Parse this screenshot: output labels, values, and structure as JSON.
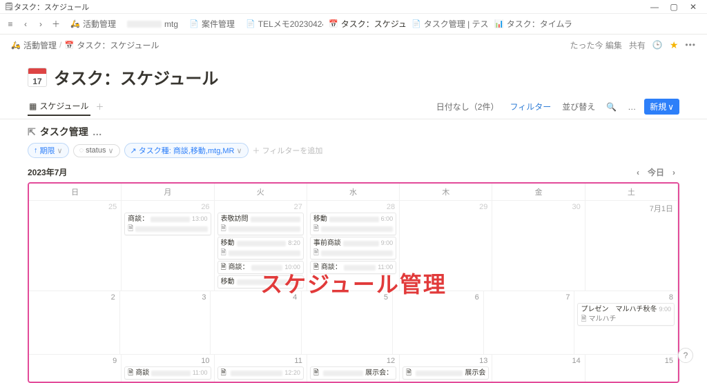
{
  "window": {
    "title": "タスク：スケジュール"
  },
  "tabs": [
    {
      "icon": "🛵",
      "label": "活動管理"
    },
    {
      "icon": "",
      "label": "mtg"
    },
    {
      "icon": "📄",
      "label": "案件管理"
    },
    {
      "icon": "📄",
      "label": "TELメモ20230424-"
    },
    {
      "icon": "📅",
      "label": "タスク：スケジュ…",
      "active": true
    },
    {
      "icon": "📄",
      "label": "タスク管理 | テス…"
    },
    {
      "icon": "📊",
      "label": "タスク：タイムラ…"
    }
  ],
  "breadcrumb": {
    "root_icon": "🛵",
    "root": "活動管理",
    "sep": "/",
    "page_icon": "📅",
    "page": "タスク：スケジュール"
  },
  "topright": {
    "edited": "たった今 編集",
    "share": "共有",
    "more": "•••"
  },
  "page": {
    "icon_num": "17",
    "title": "タスク：スケジュール"
  },
  "view": {
    "tab_label": "スケジュール",
    "plus": "＋",
    "no_date": "日付なし（2件）",
    "filter": "フィルター",
    "sort": "並び替え",
    "search_icon": "Q",
    "more": "…",
    "new": "新規",
    "new_caret": "∨"
  },
  "db": {
    "name": "タスク管理",
    "more": "…"
  },
  "filters": {
    "period": "期限",
    "period_caret": "∨",
    "status": "status",
    "status_caret": "∨",
    "task_type": "タスク種: 商談,移動,mtg,MR",
    "task_caret": "∨",
    "add": "＋ フィルターを追加",
    "updown": "↑"
  },
  "month": {
    "label": "2023年7月",
    "today": "今日",
    "lt": "‹",
    "gt": "›"
  },
  "dow": [
    "日",
    "月",
    "火",
    "水",
    "木",
    "金",
    "土"
  ],
  "weeks": [
    {
      "days": [
        {
          "n": "25",
          "other": true
        },
        {
          "n": "26",
          "other": true,
          "events": [
            {
              "t": "商談：",
              "blurred": true,
              "time": "13:00",
              "doc": true
            }
          ]
        },
        {
          "n": "27",
          "other": true,
          "events": [
            {
              "t": "表敬訪問",
              "blurred": true,
              "time": "",
              "doc": true
            },
            {
              "t": "移動",
              "blurred": true,
              "time": "8:20",
              "doc": true
            },
            {
              "t": "商談：",
              "sub": true,
              "blurred": true,
              "time": "10:00"
            },
            {
              "t": "移動",
              "blurred": true,
              "time": "",
              "doc": false
            }
          ]
        },
        {
          "n": "28",
          "other": true,
          "events": [
            {
              "t": "移動",
              "blurred": true,
              "time": "6:00",
              "doc": true
            },
            {
              "t": "事前商談",
              "blurred": true,
              "time": "9:00",
              "doc": true
            },
            {
              "t": "商談：",
              "sub": true,
              "blurred": true,
              "time": "11:00"
            }
          ]
        },
        {
          "n": "29",
          "other": true
        },
        {
          "n": "30",
          "other": true
        },
        {
          "n": "7月1日"
        }
      ]
    },
    {
      "days": [
        {
          "n": "2"
        },
        {
          "n": "3"
        },
        {
          "n": "4"
        },
        {
          "n": "5"
        },
        {
          "n": "6"
        },
        {
          "n": "7"
        },
        {
          "n": "8",
          "events": [
            {
              "t": "プレゼン　マルハチ秋冬",
              "time": "9:00",
              "doclabel": "マルハチ"
            }
          ]
        }
      ]
    },
    {
      "days": [
        {
          "n": "9"
        },
        {
          "n": "10",
          "events": [
            {
              "t": "商談",
              "blurred": true,
              "time": "11:00",
              "sub": true
            }
          ]
        },
        {
          "n": "11",
          "events": [
            {
              "t": "",
              "blurred": true,
              "time": "12:20",
              "sub": true
            }
          ]
        },
        {
          "n": "12",
          "events": [
            {
              "t": "",
              "blurred": true,
              "tail": "展示会：",
              "sub": true
            }
          ]
        },
        {
          "n": "13",
          "events": [
            {
              "t": "",
              "blurred": true,
              "tail": "展示会",
              "sub": true
            }
          ]
        },
        {
          "n": "14"
        },
        {
          "n": "15"
        }
      ],
      "short": true
    }
  ],
  "overlay": "スケジュール管理",
  "help": "?"
}
